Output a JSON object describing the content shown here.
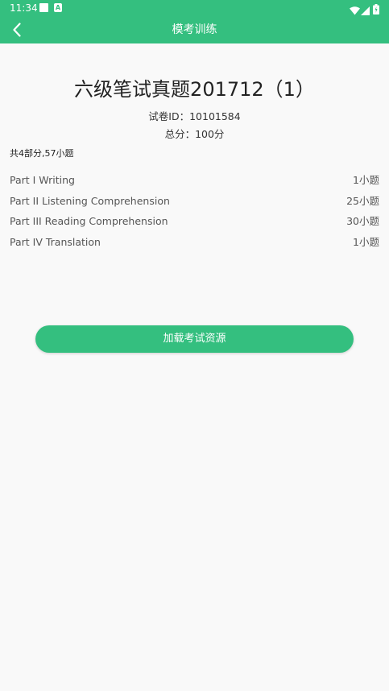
{
  "status_bar": {
    "time": "11:34",
    "icons": [
      "notification-square-icon",
      "a-badge-icon",
      "wifi-icon",
      "signal-icon",
      "battery-icon"
    ]
  },
  "app_bar": {
    "title": "模考训练",
    "back_icon": "chevron-left-icon"
  },
  "paper": {
    "title": "六级笔试真题201712（1）",
    "id_label": "试卷ID：",
    "id_value": "10101584",
    "score_label": "总分：",
    "score_value": "100分",
    "summary": "共4部分,57小题"
  },
  "parts": [
    {
      "name": "Part I Writing",
      "count": "1小题"
    },
    {
      "name": "Part II Listening Comprehension",
      "count": "25小题"
    },
    {
      "name": "Part III Reading Comprehension",
      "count": "30小题"
    },
    {
      "name": "Part IV Translation",
      "count": "1小题"
    }
  ],
  "actions": {
    "load_label": "加载考试资源"
  },
  "colors": {
    "accent": "#34bf7f",
    "background": "#f9f9f9",
    "text_primary": "#222222",
    "text_secondary": "#555555"
  }
}
